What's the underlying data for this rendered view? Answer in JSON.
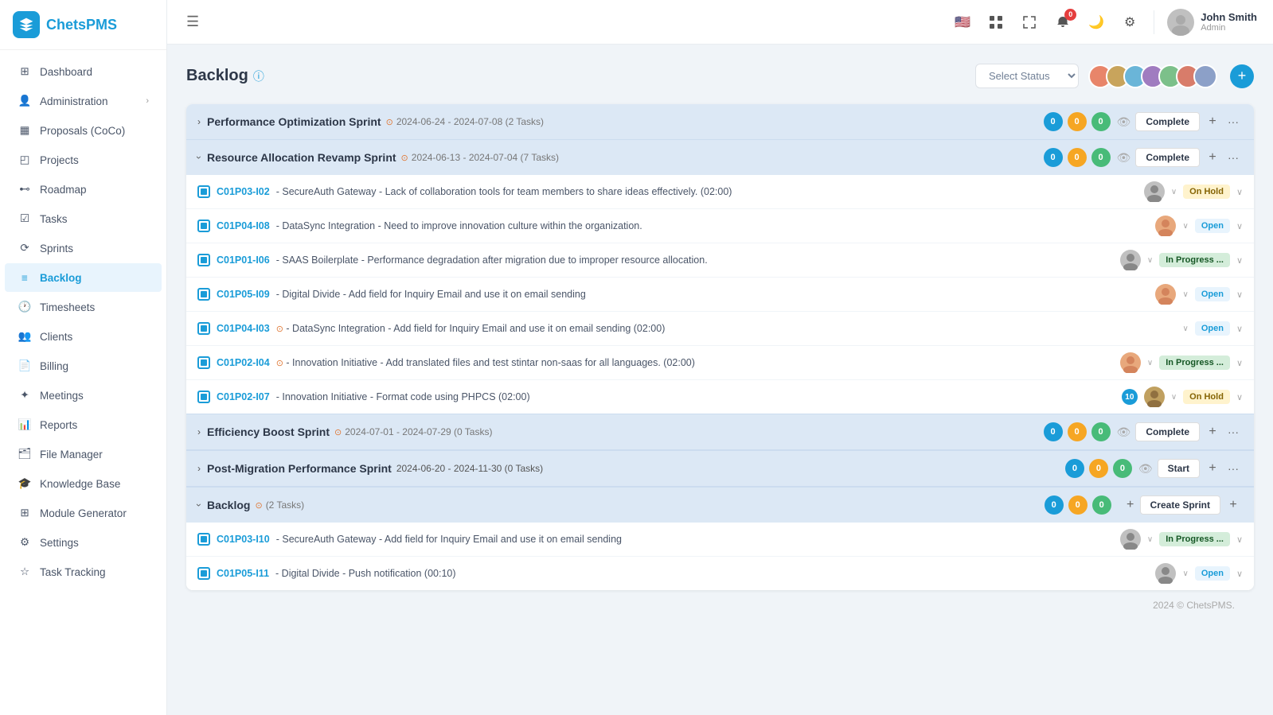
{
  "app": {
    "name": "ChetsPMS",
    "logo_text": "ChetsPMS"
  },
  "sidebar": {
    "items": [
      {
        "label": "Dashboard",
        "icon": "dashboard-icon",
        "active": false
      },
      {
        "label": "Administration",
        "icon": "admin-icon",
        "active": false,
        "arrow": true
      },
      {
        "label": "Proposals (CoCo)",
        "icon": "proposals-icon",
        "active": false
      },
      {
        "label": "Projects",
        "icon": "projects-icon",
        "active": false
      },
      {
        "label": "Roadmap",
        "icon": "roadmap-icon",
        "active": false
      },
      {
        "label": "Tasks",
        "icon": "tasks-icon",
        "active": false
      },
      {
        "label": "Sprints",
        "icon": "sprints-icon",
        "active": false
      },
      {
        "label": "Backlog",
        "icon": "backlog-icon",
        "active": true
      },
      {
        "label": "Timesheets",
        "icon": "timesheets-icon",
        "active": false
      },
      {
        "label": "Clients",
        "icon": "clients-icon",
        "active": false
      },
      {
        "label": "Billing",
        "icon": "billing-icon",
        "active": false
      },
      {
        "label": "Meetings",
        "icon": "meetings-icon",
        "active": false
      },
      {
        "label": "Reports",
        "icon": "reports-icon",
        "active": false
      },
      {
        "label": "File Manager",
        "icon": "filemanager-icon",
        "active": false
      },
      {
        "label": "Knowledge Base",
        "icon": "knowledgebase-icon",
        "active": false
      },
      {
        "label": "Module Generator",
        "icon": "modulegen-icon",
        "active": false
      },
      {
        "label": "Settings",
        "icon": "settings-icon",
        "active": false
      },
      {
        "label": "Task Tracking",
        "icon": "tasktracking-icon",
        "active": false
      }
    ]
  },
  "topbar": {
    "notification_count": "0",
    "user": {
      "name": "John Smith",
      "role": "Admin"
    }
  },
  "page": {
    "title": "Backlog",
    "select_status_placeholder": "Select Status",
    "add_button": "+",
    "copyright": "2024 © ChetsPMS."
  },
  "sprints": [
    {
      "id": "sprint1",
      "name": "Performance Optimization Sprint",
      "date_range": "2024-06-24 - 2024-07-08",
      "task_count": "2 Tasks",
      "badges": [
        0,
        0,
        0
      ],
      "action_label": "Complete",
      "expanded": false
    },
    {
      "id": "sprint2",
      "name": "Resource Allocation Revamp Sprint",
      "date_range": "2024-06-13 - 2024-07-04",
      "task_count": "7 Tasks",
      "badges": [
        0,
        0,
        0
      ],
      "action_label": "Complete",
      "expanded": true,
      "tasks": [
        {
          "id": "C01P03-I02",
          "name": "SecureAuth Gateway - Lack of collaboration tools for team members to share ideas effectively. (02:00)",
          "avatar_color": "#c0c0c0",
          "status": "On Hold",
          "status_class": "status-onhold",
          "has_avatar": true
        },
        {
          "id": "C01P04-I08",
          "name": "DataSync Integration - Need to improve innovation culture within the organization.",
          "avatar_color": "#e8a87c",
          "status": "Open",
          "status_class": "status-open",
          "has_avatar": true
        },
        {
          "id": "C01P01-I06",
          "name": "SAAS Boilerplate - Performance degradation after migration due to improper resource allocation.",
          "avatar_color": "#c0c0c0",
          "status": "In Progress ...",
          "status_class": "status-inprogress",
          "has_avatar": true,
          "has_warning": true
        },
        {
          "id": "C01P05-I09",
          "name": "Digital Divide - Add field for Inquiry Email and use it on email sending",
          "avatar_color": "#e8a87c",
          "status": "Open",
          "status_class": "status-open",
          "has_avatar": true
        },
        {
          "id": "C01P04-I03",
          "name": "DataSync Integration - Add field for Inquiry Email and use it on email sending (02:00)",
          "avatar_color": "#c0c0c0",
          "status": "Open",
          "status_class": "status-open",
          "has_avatar": false,
          "has_warning": true
        },
        {
          "id": "C01P02-I04",
          "name": "Innovation Initiative - Add translated files and test stintar non-saas for all languages. (02:00)",
          "avatar_color": "#e8a87c",
          "status": "In Progress ...",
          "status_class": "status-inprogress",
          "has_avatar": true,
          "has_warning": true
        },
        {
          "id": "C01P02-I07",
          "name": "Innovation Initiative - Format code using PHPCS (02:00)",
          "avatar_color": "#c0a060",
          "status": "On Hold",
          "status_class": "status-onhold",
          "has_avatar": true,
          "num_badge": "10"
        }
      ]
    },
    {
      "id": "sprint3",
      "name": "Efficiency Boost Sprint",
      "date_range": "2024-07-01 - 2024-07-29",
      "task_count": "0 Tasks",
      "badges": [
        0,
        0,
        0
      ],
      "action_label": "Complete",
      "expanded": false,
      "has_warning": true
    },
    {
      "id": "sprint4",
      "name": "Post-Migration Performance Sprint",
      "date_range": "2024-06-20 - 2024-11-30",
      "task_count": "0 Tasks",
      "badges": [
        0,
        0,
        0
      ],
      "action_label": "Start",
      "expanded": false
    },
    {
      "id": "backlog",
      "name": "Backlog",
      "date_range": "",
      "task_count": "2 Tasks",
      "badges": [
        0,
        0,
        0
      ],
      "action_label": "Create Sprint",
      "expanded": true,
      "is_backlog": true,
      "tasks": [
        {
          "id": "C01P03-I10",
          "name": "SecureAuth Gateway - Add field for Inquiry Email and use it on email sending",
          "avatar_color": "#c0c0c0",
          "status": "In Progress ...",
          "status_class": "status-inprogress",
          "has_avatar": true
        },
        {
          "id": "C01P05-I11",
          "name": "Digital Divide - Push notification (00:10)",
          "avatar_color": "#c0c0c0",
          "status": "Open",
          "status_class": "status-open",
          "has_avatar": true
        }
      ]
    }
  ],
  "avatar_colors": [
    "#e8856a",
    "#c8a45c",
    "#6ab5d8",
    "#a07cc0",
    "#7cc08a",
    "#d87c6a",
    "#8ca0c8"
  ]
}
